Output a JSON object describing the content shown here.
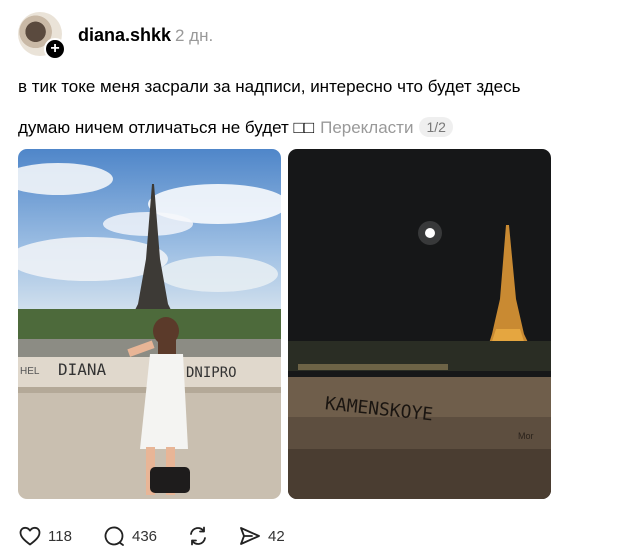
{
  "post": {
    "username": "diana.shkk",
    "timestamp": "2 дн.",
    "text_line1": "в тик токе меня засрали за надписи, интересно что будет здесь",
    "text_line2": "думаю ничем отличаться не будет □□",
    "translate_label": "Перекласти",
    "page_indicator": "1/2"
  },
  "media": {
    "photo1": {
      "graffiti_left": "DIANA",
      "graffiti_right": "DNIPRO",
      "graffiti_small": "HEL"
    },
    "photo2": {
      "graffiti_main": "KAMENSKOYE",
      "graffiti_small": "Mor"
    }
  },
  "actions": {
    "likes": "118",
    "comments": "436",
    "shares": "42"
  },
  "icons": {
    "avatar_badge": "plus-icon",
    "like": "heart-icon",
    "comment": "comment-icon",
    "repost": "repost-icon",
    "share": "send-icon"
  }
}
